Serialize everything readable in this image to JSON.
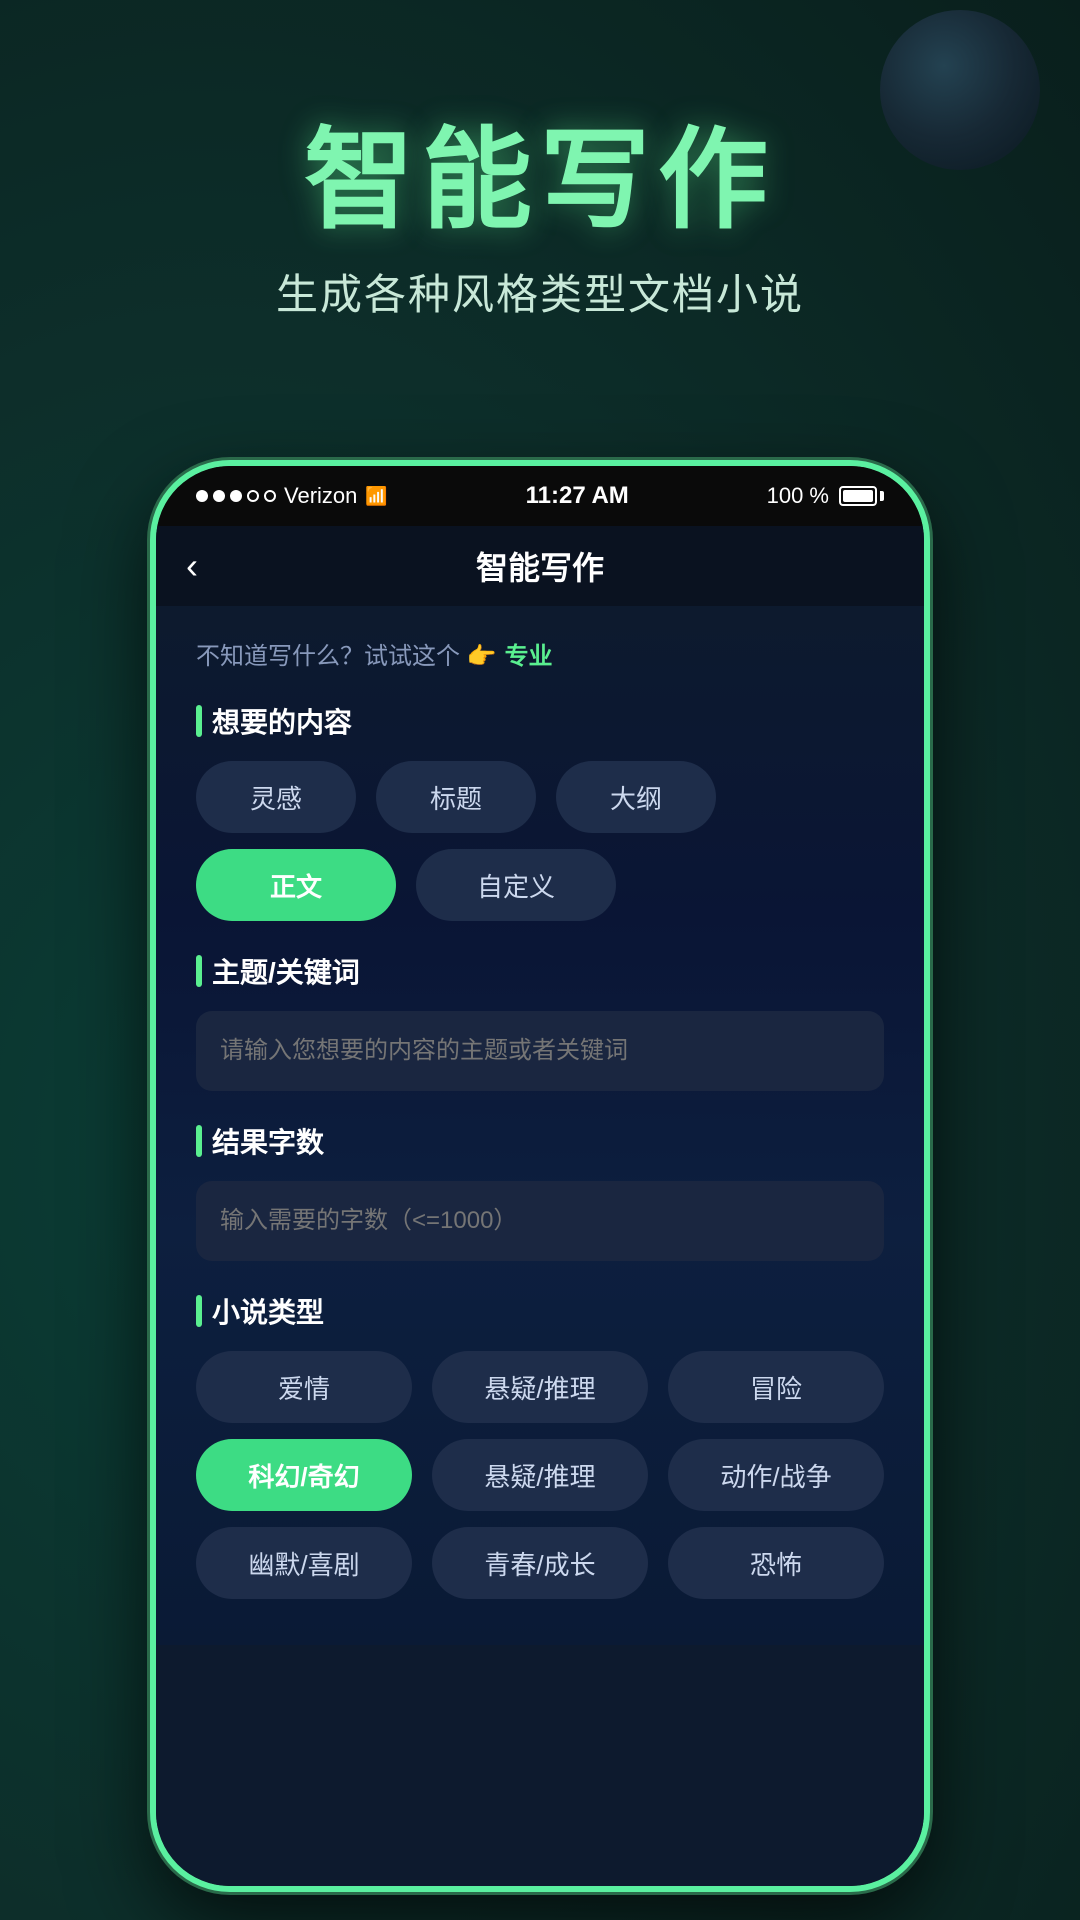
{
  "hero": {
    "title": "智能写作",
    "subtitle": "生成各种风格类型文档小说"
  },
  "status_bar": {
    "carrier": "Verizon",
    "time": "11:27 AM",
    "battery": "100 %"
  },
  "nav": {
    "back_icon": "‹",
    "title": "智能写作"
  },
  "hint": {
    "text": "不知道写什么？试试这个 👉",
    "professional": "专业"
  },
  "section_content": {
    "label": "想要的内容",
    "buttons": [
      {
        "id": "inspiration",
        "label": "灵感",
        "active": false
      },
      {
        "id": "headline",
        "label": "标题",
        "active": false
      },
      {
        "id": "outline",
        "label": "大纲",
        "active": false
      },
      {
        "id": "body",
        "label": "正文",
        "active": true
      },
      {
        "id": "custom",
        "label": "自定义",
        "active": false
      }
    ]
  },
  "section_theme": {
    "label": "主题/关键词",
    "placeholder": "请输入您想要的内容的主题或者关键词"
  },
  "section_wordcount": {
    "label": "结果字数",
    "placeholder": "输入需要的字数（<=1000）"
  },
  "section_genre": {
    "label": "小说类型",
    "rows": [
      [
        {
          "id": "romance",
          "label": "爱情",
          "active": false
        },
        {
          "id": "mystery1",
          "label": "悬疑/推理",
          "active": false
        },
        {
          "id": "adventure",
          "label": "冒险",
          "active": false
        }
      ],
      [
        {
          "id": "scifi",
          "label": "科幻/奇幻",
          "active": true
        },
        {
          "id": "mystery2",
          "label": "悬疑/推理",
          "active": false
        },
        {
          "id": "action",
          "label": "动作/战争",
          "active": false
        }
      ],
      [
        {
          "id": "comedy",
          "label": "幽默/喜剧",
          "active": false
        },
        {
          "id": "youth",
          "label": "青春/成长",
          "active": false
        },
        {
          "id": "horror",
          "label": "恐怖",
          "active": false
        }
      ]
    ]
  }
}
